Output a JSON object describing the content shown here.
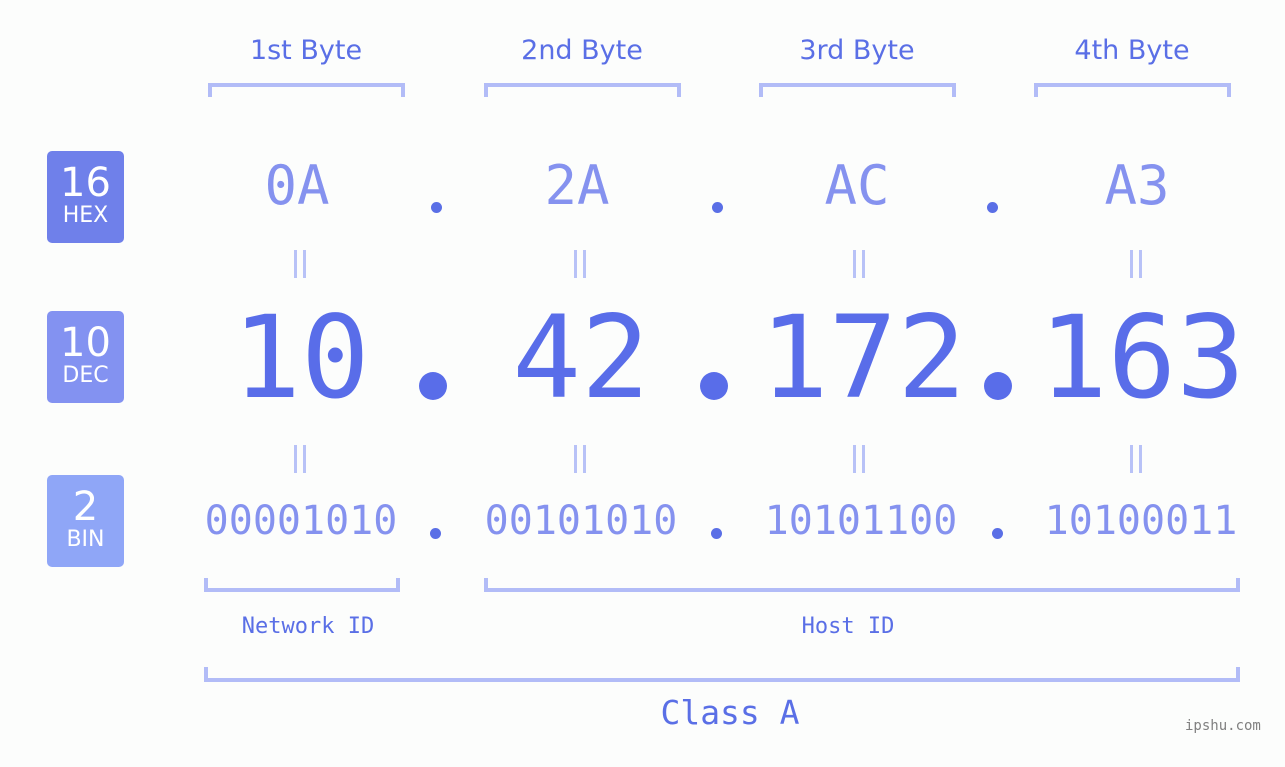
{
  "bytes": [
    {
      "label": "1st Byte",
      "hex": "0A",
      "dec": "10",
      "bin": "00001010"
    },
    {
      "label": "2nd Byte",
      "hex": "2A",
      "dec": "42",
      "bin": "00101010"
    },
    {
      "label": "3rd Byte",
      "hex": "AC",
      "dec": "172",
      "bin": "10101100"
    },
    {
      "label": "4th Byte",
      "hex": "A3",
      "dec": "163",
      "bin": "10100011"
    }
  ],
  "bases": {
    "hex": {
      "num": "16",
      "unit": "HEX",
      "color": "#6f80ea"
    },
    "dec": {
      "num": "10",
      "unit": "DEC",
      "color": "#8392f1"
    },
    "bin": {
      "num": "2",
      "unit": "BIN",
      "color": "#8fa6f7"
    }
  },
  "separator": ".",
  "network_id_label": "Network ID",
  "host_id_label": "Host ID",
  "class_label": "Class A",
  "watermark": "ipshu.com",
  "colors": {
    "accent": "#596de9",
    "light": "#8592ef",
    "bracket": "#b2bcf7"
  }
}
